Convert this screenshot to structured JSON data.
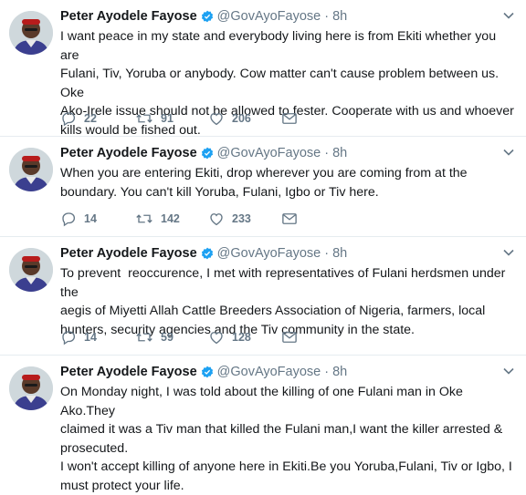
{
  "author": {
    "name": "Peter Ayodele Fayose",
    "handle": "@GovAyoFayose",
    "separator": "·"
  },
  "colors": {
    "verified": "#1da1f2",
    "meta_gray": "#657786",
    "divider": "#e6ecf0",
    "text": "#14171a"
  },
  "tweets": [
    {
      "time": "8h",
      "text": "I want peace in my state and everybody living here is from Ekiti whether you are\nFulani, Tiv, Yoruba or anybody. Cow matter can't cause problem between us. Oke\nAko-Irele issue should not be allowed to fester. Cooperate with us and whoever\nkills would be fished out.",
      "replies": "22",
      "retweets": "91",
      "likes": "206"
    },
    {
      "time": "8h",
      "text": "When you are entering Ekiti, drop wherever you are coming from at the\nboundary. You can't kill Yoruba, Fulani, Igbo or Tiv here.",
      "replies": "14",
      "retweets": "142",
      "likes": "233"
    },
    {
      "time": "8h",
      "text": "To prevent  reoccurence, I met with representatives of Fulani herdsmen under the\naegis of Miyetti Allah Cattle Breeders Association of Nigeria, farmers, local\nhunters, security agencies and the Tiv community in the state.",
      "replies": "14",
      "retweets": "59",
      "likes": "128"
    },
    {
      "time": "8h",
      "text": "On Monday night, I was told about the killing of one Fulani man in Oke Ako.They\nclaimed it was a Tiv man that killed the Fulani man,I want the killer arrested &\nprosecuted.\nI won't accept killing of anyone here in Ekiti.Be you Yoruba,Fulani, Tiv or Igbo, I\nmust protect your life."
    }
  ],
  "icons": {
    "reply": "reply-icon",
    "retweet": "retweet-icon",
    "like": "heart-icon",
    "dm": "envelope-icon",
    "verified": "verified-badge-icon",
    "caret": "chevron-down-icon"
  }
}
